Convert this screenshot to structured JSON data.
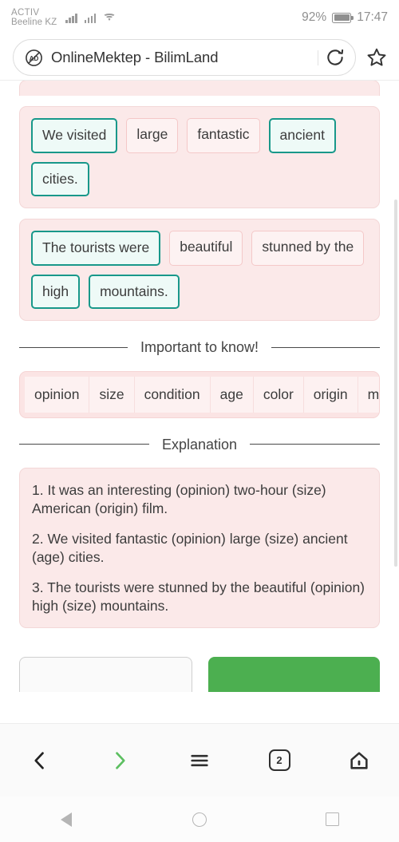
{
  "status_bar": {
    "carrier_line1": "ACTIV",
    "carrier_line2": "Beeline KZ",
    "battery_percent": "92%",
    "time": "17:47"
  },
  "browser": {
    "adblock_icon": "adblock-icon",
    "page_title": "OnlineMektep - BilimLand",
    "reload_icon": "reload-icon",
    "bookmark_icon": "star-icon",
    "toolbar": {
      "back_icon": "chevron-left-icon",
      "forward_icon": "chevron-right-icon",
      "menu_icon": "hamburger-menu-icon",
      "tabs_count": "2",
      "home_icon": "home-icon"
    },
    "accent_green": "#4caf50"
  },
  "android_nav": {
    "back_icon": "triangle-back-icon",
    "home_icon": "circle-home-icon",
    "recents_icon": "square-recents-icon"
  },
  "exercise": {
    "sentences": [
      {
        "chips": [
          {
            "text": "We visited",
            "state": "correct"
          },
          {
            "text": "large",
            "state": "wrong"
          },
          {
            "text": "fantastic",
            "state": "wrong"
          },
          {
            "text": "ancient",
            "state": "correct"
          },
          {
            "text": "cities.",
            "state": "correct"
          }
        ]
      },
      {
        "chips": [
          {
            "text": "The tourists were",
            "state": "correct"
          },
          {
            "text": "beautiful",
            "state": "wrong"
          },
          {
            "text": "stunned by the",
            "state": "wrong"
          },
          {
            "text": "high",
            "state": "correct"
          },
          {
            "text": "mountains.",
            "state": "correct"
          }
        ]
      }
    ]
  },
  "important_section": {
    "divider_label": "Important to know!",
    "order_cells": [
      "opinion",
      "size",
      "condition",
      "age",
      "color",
      "origin",
      "material"
    ]
  },
  "explanation_section": {
    "divider_label": "Explanation",
    "items": [
      "1. It was an interesting (opinion) two-hour (size) American (origin) film.",
      "2. We visited fantastic (opinion) large (size) ancient (age) cities.",
      "3. The tourists were stunned by the beautiful (opinion) high (size) mountains."
    ]
  },
  "page_actions": {
    "secondary_label": "",
    "primary_label": ""
  },
  "colors": {
    "correct_border": "#18988a",
    "wrong_border": "#f4c8c8",
    "card_bg": "#fbe9e9"
  }
}
